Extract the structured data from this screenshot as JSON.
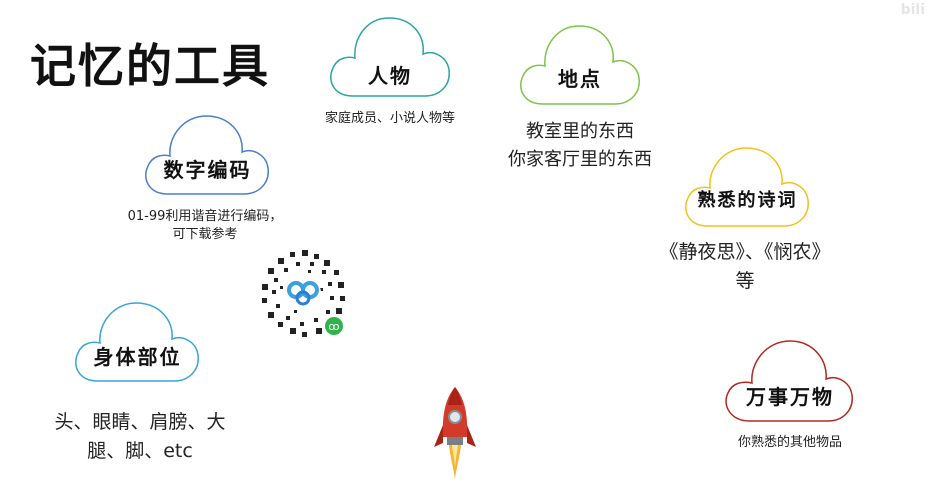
{
  "title": "记忆的工具",
  "watermark": "bili",
  "clouds": {
    "people": {
      "label": "人物",
      "desc": "家庭成员、小说人物等",
      "color": "#2aa5a0"
    },
    "places": {
      "label": "地点",
      "desc_lines": [
        "教室里的东西",
        "你家客厅里的东西"
      ],
      "color": "#7cc44a"
    },
    "digits": {
      "label": "数字编码",
      "desc_lines": [
        "01-99利用谐音进行编码，",
        "可下载参考"
      ],
      "color": "#4a7fcb"
    },
    "poems": {
      "label": "熟悉的诗词",
      "desc_lines": [
        "《静夜思》、《悯农》",
        "等"
      ],
      "color": "#f2c21b"
    },
    "body": {
      "label": "身体部位",
      "desc_lines": [
        "头、眼睛、肩膀、大",
        "腿、脚、etc"
      ],
      "color": "#3aa4d8"
    },
    "things": {
      "label": "万事万物",
      "desc": "你熟悉的其他物品",
      "color": "#b0281e"
    }
  },
  "icons": {
    "qr": "qr-code-icon",
    "rocket": "rocket-icon"
  }
}
